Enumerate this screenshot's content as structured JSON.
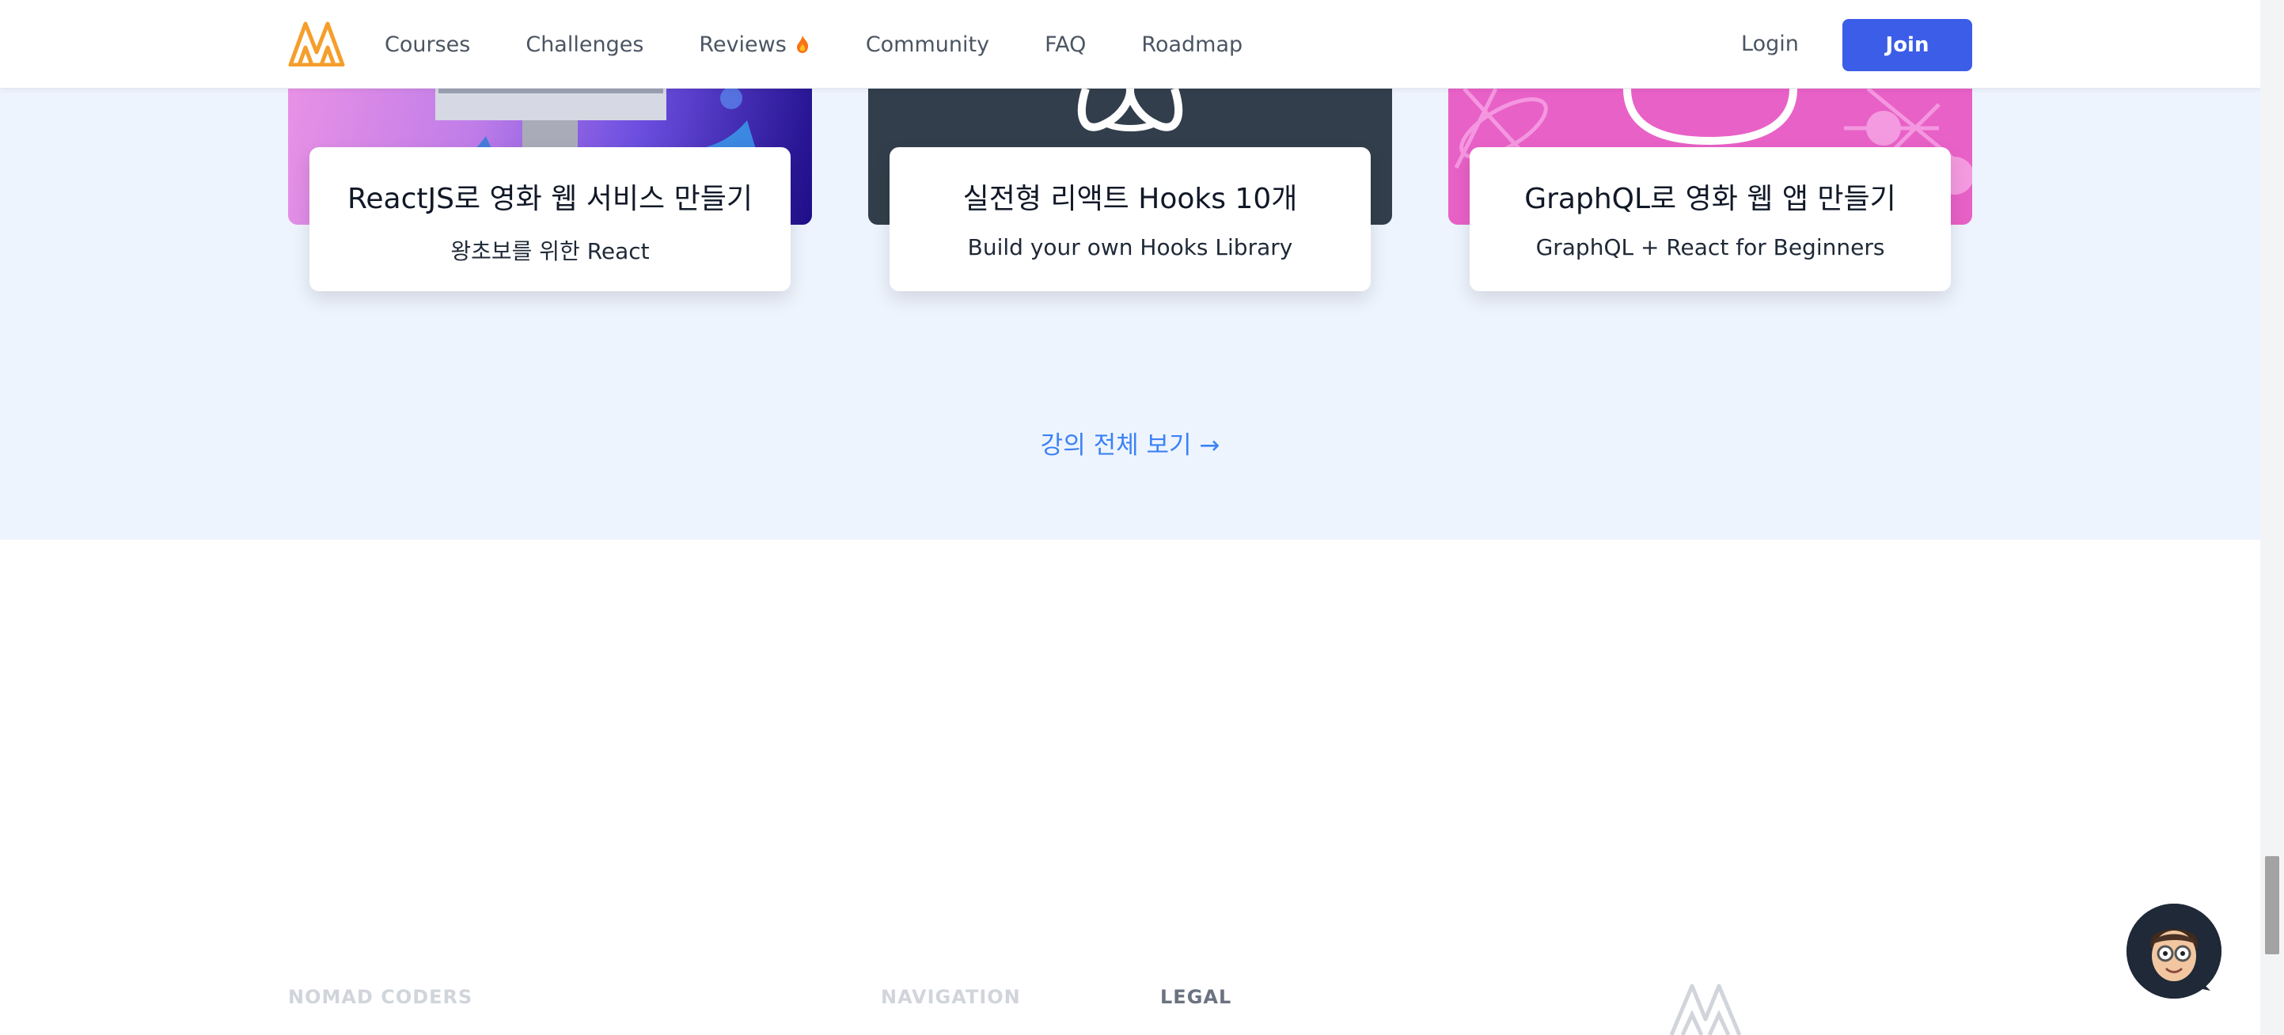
{
  "header": {
    "logo_icon": "nomad-coders-logo-icon",
    "nav": [
      "Courses",
      "Challenges",
      "Reviews",
      "Community",
      "FAQ",
      "Roadmap"
    ],
    "reviews_badge_icon": "fire-icon",
    "login_label": "Login",
    "join_label": "Join"
  },
  "courses": [
    {
      "title": "ReactJS로 영화 웹 서비스 만들기",
      "subtitle": "왕초보를 위한 React"
    },
    {
      "title": "실전형 리액트 Hooks 10개",
      "subtitle": "Build your own Hooks Library"
    },
    {
      "title": "GraphQL로 영화 웹 앱 만들기",
      "subtitle": "GraphQL + React for Beginners"
    }
  ],
  "see_all_label": "강의 전체 보기 →",
  "footer": {
    "columns": [
      "NOMAD CODERS",
      "NAVIGATION",
      "LEGAL"
    ]
  },
  "colors": {
    "accent": "#3b5de7",
    "link": "#3b82f6",
    "logo": "#f59e2b",
    "section_bg": "#eef4fe"
  }
}
